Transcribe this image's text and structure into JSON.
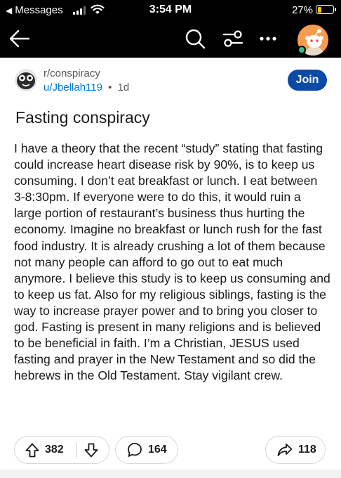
{
  "status_bar": {
    "back_label": "Messages",
    "time": "3:54 PM",
    "battery_percent": "27%",
    "battery_level": 0.27,
    "battery_color": "#f5c400",
    "icons": [
      "back-triangle",
      "cellular-signal",
      "wifi",
      "battery"
    ]
  },
  "nav": {
    "icons": [
      "back-arrow-icon",
      "search-icon",
      "filter-sliders-icon",
      "more-dots-icon",
      "user-avatar"
    ],
    "background": "#000000",
    "avatar_color": "#f79c4f",
    "online_color": "#31c48d"
  },
  "post": {
    "subreddit": "r/conspiracy",
    "author": "u/Jbellah119",
    "separator": "•",
    "age": "1d",
    "join_label": "Join",
    "join_color": "#0c4aa8",
    "title": "Fasting conspiracy",
    "body": "I have a theory that the recent “study” stating that fasting could increase heart disease risk by 90%, is to keep us consuming. I don’t eat breakfast or lunch. I eat between 3-8:30pm. If everyone were to do this, it would ruin a large portion of restaurant’s business thus hurting the economy. Imagine no breakfast or lunch rush for the fast food industry. It is already crushing a lot of them because not many people can afford to go out to eat much anymore. I believe this study is to keep us consuming and to keep us fat. Also for my religious siblings, fasting is the way to increase prayer power and to bring you closer to god. Fasting is present in many religions and is believed to be beneficial in faith. I’m a Christian, JESUS used fasting and prayer in the New Testament and so did the hebrews in the Old Testament. Stay vigilant crew."
  },
  "actions": {
    "upvotes": "382",
    "comments": "164",
    "shares": "118",
    "icons": [
      "upvote-icon",
      "downvote-icon",
      "comment-icon",
      "share-icon"
    ]
  }
}
